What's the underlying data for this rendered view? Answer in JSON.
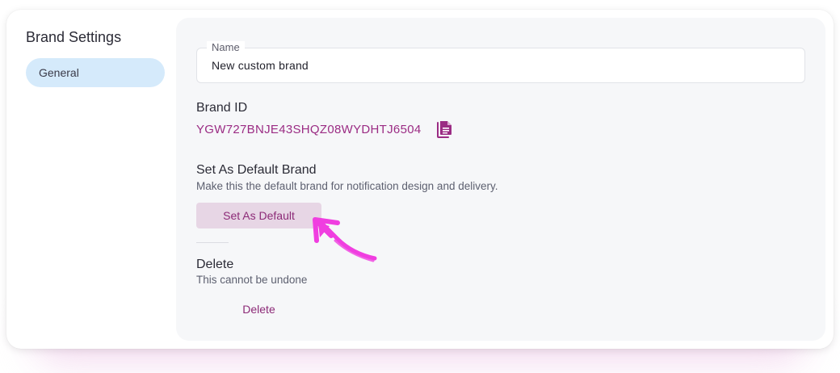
{
  "sidebar": {
    "title": "Brand Settings",
    "items": [
      {
        "label": "General",
        "active": true
      }
    ]
  },
  "name_field": {
    "label": "Name",
    "value": "New custom brand"
  },
  "brand_id": {
    "heading": "Brand ID",
    "value": "YGW727BNJE43SHQZ08WYDHTJ6504",
    "copy_icon": "copy-document-icon"
  },
  "default_brand": {
    "heading": "Set As Default Brand",
    "description": "Make this the default brand for notification design and delivery.",
    "button_label": "Set As Default"
  },
  "delete_section": {
    "heading": "Delete",
    "description": "This cannot be undone",
    "button_label": "Delete"
  },
  "colors": {
    "accent": "#9b2c84",
    "sidebar_active_bg": "#d5eafb",
    "button_bg": "#e7d6e5",
    "annotation": "#f03ee0"
  }
}
